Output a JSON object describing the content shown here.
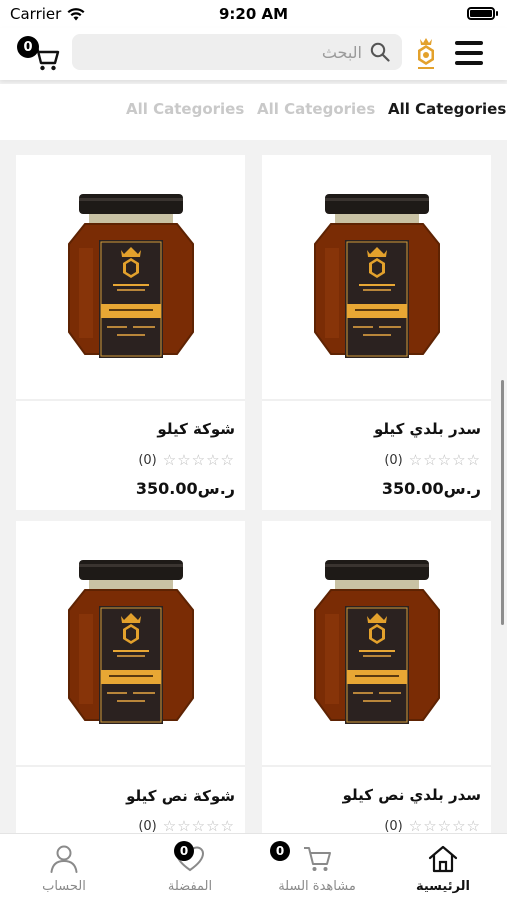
{
  "status_bar": {
    "carrier": "Carrier",
    "time": "9:20 AM"
  },
  "header": {
    "cart_count": "0",
    "search_placeholder": "البحث"
  },
  "tabs": [
    {
      "label": "All Categories",
      "active": false
    },
    {
      "label": "All Categories",
      "active": false
    },
    {
      "label": "All Categories",
      "active": true
    }
  ],
  "products": [
    {
      "name": "سدر بلدي كيلو",
      "rating_count": "(0)",
      "price": "ر.س350.00"
    },
    {
      "name": "شوكة كيلو",
      "rating_count": "(0)",
      "price": "ر.س350.00"
    },
    {
      "name": "سدر بلدي نص كيلو",
      "rating_count": "(0)",
      "price": ""
    },
    {
      "name": "شوكة نص كيلو",
      "rating_count": "(0)",
      "price": ""
    }
  ],
  "bottom_nav": {
    "home": "الرئيسية",
    "cart": "مشاهدة السلة",
    "cart_count": "0",
    "favorites": "المفضلة",
    "favorites_count": "0",
    "account": "الحساب"
  },
  "colors": {
    "accent": "#000000",
    "honey": "#7a2c05",
    "label_gold": "#e8a734"
  }
}
